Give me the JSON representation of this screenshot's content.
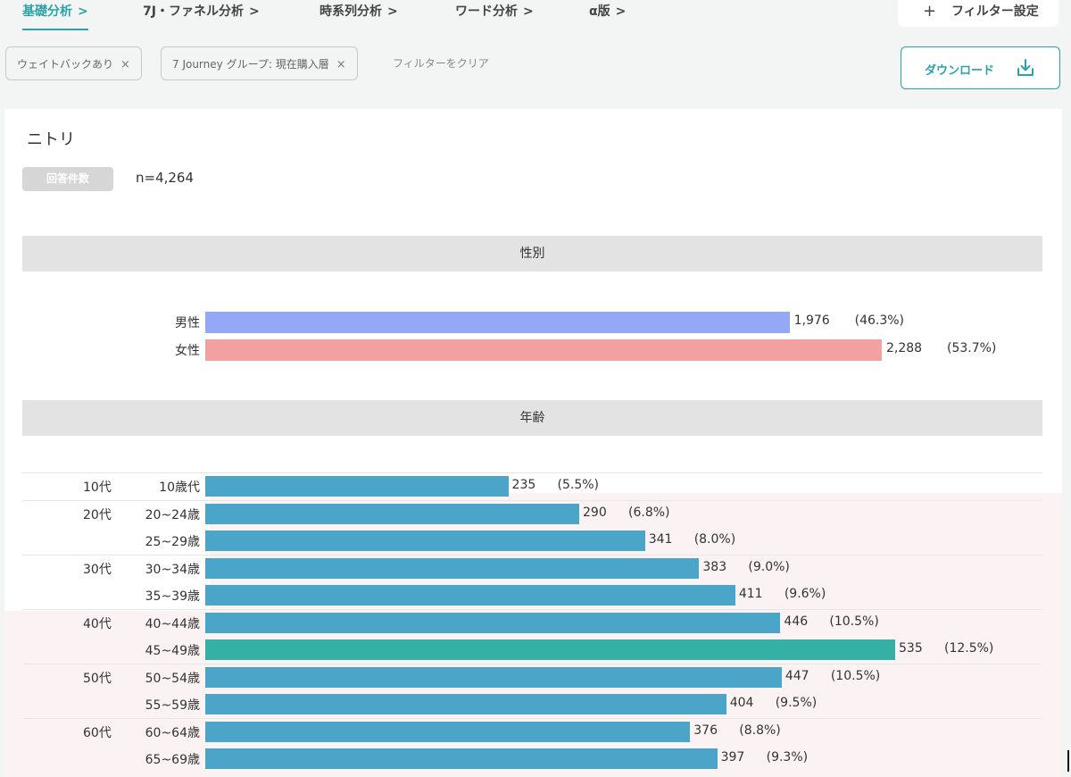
{
  "tabs": [
    {
      "label": "基礎分析",
      "active": true
    },
    {
      "label": "7J・ファネル分析",
      "active": false
    },
    {
      "label": "時系列分析",
      "active": false
    },
    {
      "label": "ワード分析",
      "active": false
    },
    {
      "label": "α版",
      "active": false
    }
  ],
  "tab_chevron": ">",
  "filter_settings": {
    "icon": "plus-icon",
    "label": "フィルター設定"
  },
  "filters": {
    "chips": [
      {
        "label": "ウェイトバックあり",
        "close": "×"
      },
      {
        "label": "7 Journey グループ: 現在購入層",
        "close": "×"
      }
    ],
    "clear_label": "フィルターをクリア"
  },
  "download": {
    "label": "ダウンロード",
    "icon": "download-icon"
  },
  "brand": "ニトリ",
  "response_count": {
    "badge": "回答件数",
    "value": "n=4,264"
  },
  "colors": {
    "accent": "#2aa3a8",
    "male": "#95a8f8",
    "female": "#f3a0a0",
    "age_bar": "#4ba5c9",
    "age_bar_peak": "#35b0a4",
    "band": "#fbf3f3"
  },
  "chart_data": [
    {
      "type": "bar",
      "title": "性別",
      "categories": [
        "男性",
        "女性"
      ],
      "values": [
        1976,
        2288
      ],
      "value_labels": [
        "1,976",
        "2,288"
      ],
      "percent_labels": [
        "(46.3%)",
        "(53.7%)"
      ],
      "percents": [
        46.3,
        53.7
      ]
    },
    {
      "type": "bar",
      "title": "年齢",
      "groups": [
        {
          "label": "10代",
          "categories": [
            "10歳代"
          ]
        },
        {
          "label": "20代",
          "categories": [
            "20~24歳",
            "25~29歳"
          ]
        },
        {
          "label": "30代",
          "categories": [
            "30~34歳",
            "35~39歳"
          ]
        },
        {
          "label": "40代",
          "categories": [
            "40~44歳",
            "45~49歳"
          ]
        },
        {
          "label": "50代",
          "categories": [
            "50~54歳",
            "55~59歳"
          ]
        },
        {
          "label": "60代",
          "categories": [
            "60~64歳",
            "65~69歳"
          ]
        }
      ],
      "categories": [
        "10歳代",
        "20~24歳",
        "25~29歳",
        "30~34歳",
        "35~39歳",
        "40~44歳",
        "45~49歳",
        "50~54歳",
        "55~59歳",
        "60~64歳",
        "65~69歳"
      ],
      "values": [
        235,
        290,
        341,
        383,
        411,
        446,
        535,
        447,
        404,
        376,
        397
      ],
      "percent_labels": [
        "(5.5%)",
        "(6.8%)",
        "(8.0%)",
        "(9.0%)",
        "(9.6%)",
        "(10.5%)",
        "(12.5%)",
        "(10.5%)",
        "(9.5%)",
        "(8.8%)",
        "(9.3%)"
      ],
      "percents": [
        5.5,
        6.8,
        8.0,
        9.0,
        9.6,
        10.5,
        12.5,
        10.5,
        9.5,
        8.8,
        9.3
      ]
    }
  ]
}
